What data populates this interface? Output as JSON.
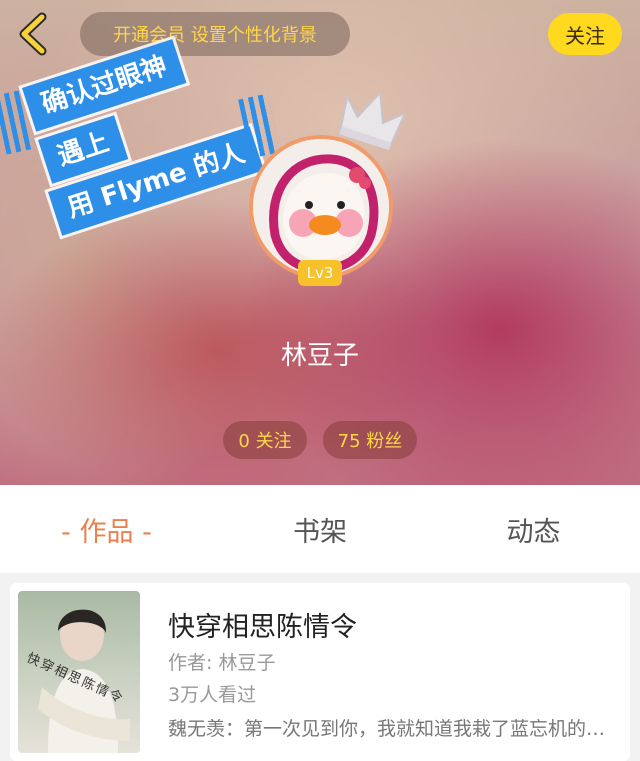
{
  "header": {
    "vip_promo": "开通会员 设置个性化背景",
    "follow_label": "关注"
  },
  "sticker": {
    "line1": "确认过眼神",
    "line2": "遇上",
    "line3": "用 Flyme 的人"
  },
  "profile": {
    "level": "Lv3",
    "name": "林豆子",
    "following": "0 关注",
    "followers": "75 粉丝"
  },
  "tabs": [
    {
      "label": "- 作品 -",
      "active": true
    },
    {
      "label": "书架",
      "active": false
    },
    {
      "label": "动态",
      "active": false
    }
  ],
  "works": [
    {
      "title": "快穿相思陈情令",
      "author": "作者: 林豆子",
      "views": "3万人看过",
      "description": "魏无羡：第一次见到你，我就知道我栽了蓝忘机的坑里",
      "cover_text": "快穿相思陈情令"
    }
  ],
  "colors": {
    "accent": "#e8814e",
    "follow_button": "#ffd91e",
    "sticker_blue": "#2e8fe8",
    "level_badge": "#f6c12a",
    "promo_text": "#ffd64a"
  },
  "icons": {
    "back": "chevron-left-icon",
    "crown": "crown-icon"
  }
}
